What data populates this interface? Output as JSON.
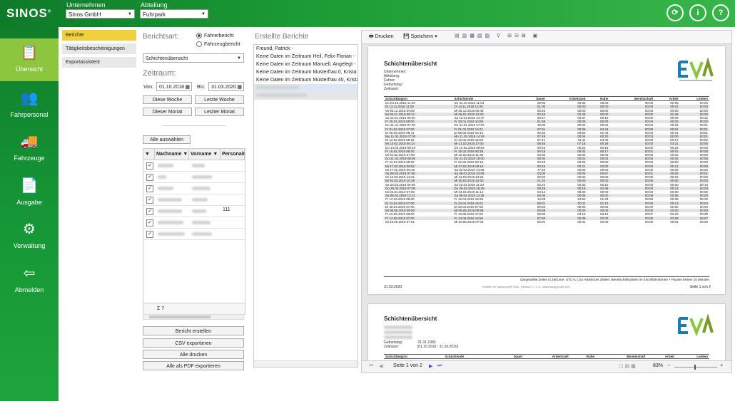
{
  "app": {
    "logo": "SINOS",
    "logo_mark": "®"
  },
  "header": {
    "unternehmen_label": "Unternehmen",
    "unternehmen_value": "Sinos GmbH",
    "abteilung_label": "Abteilung",
    "abteilung_value": "Fuhrpark"
  },
  "sidebar": [
    {
      "label": "Übersicht",
      "icon": "clipboard-icon"
    },
    {
      "label": "Fahrpersonal",
      "icon": "people-icon"
    },
    {
      "label": "Fahrzeuge",
      "icon": "truck-icon"
    },
    {
      "label": "Ausgabe",
      "icon": "document-icon"
    },
    {
      "label": "Verwaltung",
      "icon": "gears-icon"
    },
    {
      "label": "Abmelden",
      "icon": "logout-icon"
    }
  ],
  "subnav": [
    "Berichte",
    "Tätigkeitsbescheinigungen",
    "Exportassistent"
  ],
  "form": {
    "berichtsart_label": "Berichtsart:",
    "radio1": "Fahrerbericht",
    "radio2": "Fahrzeugbericht",
    "report_type": "Schichtenübersicht",
    "zeitraum_label": "Zeitraum:",
    "von_label": "Von:",
    "von_value": "01.10.2018",
    "bis_label": "Bis:",
    "bis_value": "31.03.2020",
    "btn_this_week": "Diese Woche",
    "btn_last_week": "Letzte Woche",
    "btn_this_month": "Dieser Monat",
    "btn_last_month": "Letzter Monat",
    "btn_select_all": "Alle auswählen",
    "sum_label": "Σ 7"
  },
  "grid": {
    "headers": [
      "Nachname",
      "Vorname",
      "Personalnu"
    ],
    "personal_value": "111"
  },
  "actions": [
    "Bericht erstellen",
    "CSV exportieren",
    "Alle drucken",
    "Alle als PDF exportieren"
  ],
  "reports": {
    "title": "Erstellte Berichte",
    "items": [
      "Freund, Patrick -",
      "Keine Daten im Zeitraum Heil, Felix-Florian -",
      "Keine Daten im Zeitraum Manuell, Angelegt -",
      "Keine Daten im Zeitraum Musterfrau 0, Krista 0 -",
      "Keine Daten im Zeitraum Musterfrau 40, Krista 40 -"
    ]
  },
  "viewer": {
    "print": "Drucken",
    "save": "Speichern",
    "page_info": "Seite 1 von 2",
    "zoom": "83%"
  },
  "report_page": {
    "title": "Schichtenübersicht",
    "info_labels": [
      "Unternehmen:",
      "Abteilung:",
      "Fahrer:",
      "Geburtstag:",
      "Zeitraum:"
    ],
    "geburtstag_value": "01.01.1980",
    "zeitraum_value": "(01.10.2018 - 31.03.2020)",
    "columns": [
      "Schichtbeginn",
      "Schichtende",
      "Dauer",
      "Arbeitszeit",
      "Ruhe",
      "Bereitschaft",
      "Arbeit",
      "Lenken"
    ],
    "rows": [
      [
        "Do 04.10.2018 11:49",
        "Do 04.10.2018 11:54",
        "00:05",
        "00:05",
        "00:00",
        "00:00",
        "00:05",
        "00:00"
      ],
      [
        "Di 13.11.2018 11:00",
        "Di 13.11.2018 12:00",
        "01:00",
        "00:00",
        "00:00",
        "00:00",
        "00:02",
        "00:00"
      ],
      [
        "Mi 05.12.2018 09:00",
        "Mi 05.12.2018 09:46",
        "00:46",
        "00:00",
        "00:00",
        "00:00",
        "00:00",
        "00:00"
      ],
      [
        "Mi 09.01.2019 09:12",
        "Mi 09.01.2019 12:00",
        "02:48",
        "02:48",
        "00:00",
        "00:00",
        "02:48",
        "00:00"
      ],
      [
        "Sa 12.01.2019 09:00",
        "Sa 12.01.2019 14:47",
        "05:47",
        "00:37",
        "00:10",
        "00:00",
        "00:09",
        "00:12"
      ],
      [
        "Fr 25.01.2019 09:00",
        "Fr 25.01.2019 10:58",
        "01:58",
        "00:08",
        "00:00",
        "00:04",
        "00:02",
        "00:00"
      ],
      [
        "Do 31.01.2019 07:00",
        "Do 31.01.2019 17:00",
        "10:00",
        "00:04",
        "00:31",
        "00:02",
        "00:01",
        "00:01"
      ],
      [
        "Fr 01.02.2019 07:00",
        "Fr 01.02.2019 14:01",
        "07:01",
        "00:09",
        "04:44",
        "00:00",
        "00:01",
        "00:01"
      ],
      [
        "Di 05.02.2019 08:41",
        "Di 05.02.2019 14:13",
        "05:32",
        "00:52",
        "01:44",
        "00:00",
        "00:01",
        "00:01"
      ],
      [
        "Mo 11.02.2019 07:00",
        "Mo 11.02.2019 14:49",
        "07:49",
        "00:04",
        "00:20",
        "00:03",
        "00:00",
        "00:01"
      ],
      [
        "Di 12.02.2019 08:19",
        "Di 12.02.2019 15:00",
        "07:41",
        "01:11",
        "04:45",
        "00:00",
        "00:17",
        "00:52"
      ],
      [
        "Mi 13.02.2019 08:14",
        "Mi 13.02.2019 17:00",
        "08:46",
        "07:18",
        "00:28",
        "00:00",
        "03:21",
        "03:55"
      ],
      [
        "Do 14.02.2019 08:19",
        "Do 14.02.2019 09:02",
        "00:43",
        "00:24",
        "00:19",
        "00:00",
        "00:24",
        "00:00"
      ],
      [
        "Fr 15.02.2019 08:20",
        "Fr 15.02.2019 08:38",
        "00:18",
        "00:02",
        "00:17",
        "00:01",
        "00:01",
        "00:00"
      ],
      [
        "Mi 20.02.2019 07:00",
        "Mi 20.02.2019 11:30",
        "04:30",
        "00:03",
        "00:03",
        "00:00",
        "00:02",
        "00:00"
      ],
      [
        "Do 21.02.2019 08:00",
        "Do 21.02.2019 18:00",
        "08:00",
        "00:02",
        "00:02",
        "00:00",
        "00:02",
        "00:00"
      ],
      [
        "Fr 22.02.2019 08:00",
        "Fr 22.02.2019 08:18",
        "00:18",
        "00:00",
        "00:00",
        "00:00",
        "00:00",
        "00:00"
      ],
      [
        "Mi 27.02.2019 08:52",
        "Mi 27.02.2019 09:15",
        "00:23",
        "00:21",
        "00:00",
        "00:00",
        "00:21",
        "00:00"
      ],
      [
        "Mi 27.02.2019 09:15",
        "Sa 02.03.2019 14:05",
        "77:20",
        "00:00",
        "00:00",
        "00:00",
        "00:00",
        "00:00"
      ],
      [
        "Sa 09.03.2019 07:00",
        "Sa 09.03.2019 10:08",
        "03:08",
        "00:05",
        "00:57",
        "00:01",
        "00:02",
        "00:01"
      ],
      [
        "Mi 13.03.2019 13:21",
        "Mi 13.03.2019 13:23",
        "00:02",
        "00:02",
        "00:00",
        "00:00",
        "00:02",
        "00:00"
      ],
      [
        "Mi 20.03.2019 10:28",
        "Mi 20.03.2019 12:00",
        "01:32",
        "00:00",
        "00:00",
        "00:00",
        "00:00",
        "00:00"
      ],
      [
        "Sa 23.03.2019 09:00",
        "Sa 23.03.2019 11:23",
        "02:23",
        "00:33",
        "00:12",
        "00:00",
        "00:00",
        "00:13"
      ],
      [
        "Do 28.03.2019 07:00",
        "Do 28.03.2019 15:48",
        "08:48",
        "00:19",
        "04:48",
        "00:00",
        "00:12",
        "00:03"
      ],
      [
        "Mi 03.04.2019 07:00",
        "Mi 03.04.2019 11:12",
        "04:12",
        "00:00",
        "00:00",
        "00:00",
        "00:00",
        "00:00"
      ],
      [
        "Sa 06.04.2019 13:21",
        "Sa 06.04.2019 13:26",
        "00:05",
        "00:05",
        "00:00",
        "00:00",
        "00:05",
        "00:00"
      ],
      [
        "Fr 12.04.2019 08:00",
        "Fr 12.04.2019 18:28",
        "13:28",
        "10:52",
        "01:33",
        "03:56",
        "00:38",
        "06:20"
      ],
      [
        "Di 23.04.2019 07:00",
        "Di 23.04.2019 15:01",
        "08:01",
        "00:11",
        "01:13",
        "00:00",
        "00:13",
        "00:04"
      ],
      [
        "Di 30.04.2019 07:00",
        "Di 30.04.2019 07:55",
        "00:55",
        "00:00",
        "00:00",
        "00:00",
        "00:00",
        "00:00"
      ],
      [
        "Mi 08.05.2019 09:00",
        "Mi 08.05.2019 09:58",
        "00:58",
        "00:00",
        "00:00",
        "00:00",
        "00:00",
        "00:00"
      ],
      [
        "Fr 10.05.2019 08:00",
        "Fr 10.05.2019 17:00",
        "09:00",
        "03:18",
        "03:14",
        "00:07",
        "02:33",
        "00:38"
      ],
      [
        "Fr 14.06.2019 07:00",
        "Fr 14.06.2019 14:50",
        "07:50",
        "05:38",
        "02:02",
        "00:00",
        "03:28",
        "02:07"
      ],
      [
        "Mi 19.06.2019 07:01",
        "Mi 19.06.2019 07:02",
        "00:01",
        "00:01",
        "00:00",
        "00:00",
        "00:01",
        "00:00"
      ]
    ],
    "footnote": "Dargestellte Zeiten in Zeitzone: UTC+1 | Zur Arbeitszeit zählen: Bereitschaftszeiten im Einzelfahrbetrieb + Pausen kleiner 15 Minuten",
    "date": "31.03.2020",
    "produced": "Erstellt mit Tachonova® EVA - Version 1.7.1.6 - www.haug-gmbh.com",
    "page": "Seite 1 von 2"
  },
  "colors": {
    "green_dark": "#0e7a2a",
    "green_light": "#8cc63f",
    "subnav_active": "#f2cf3c"
  }
}
